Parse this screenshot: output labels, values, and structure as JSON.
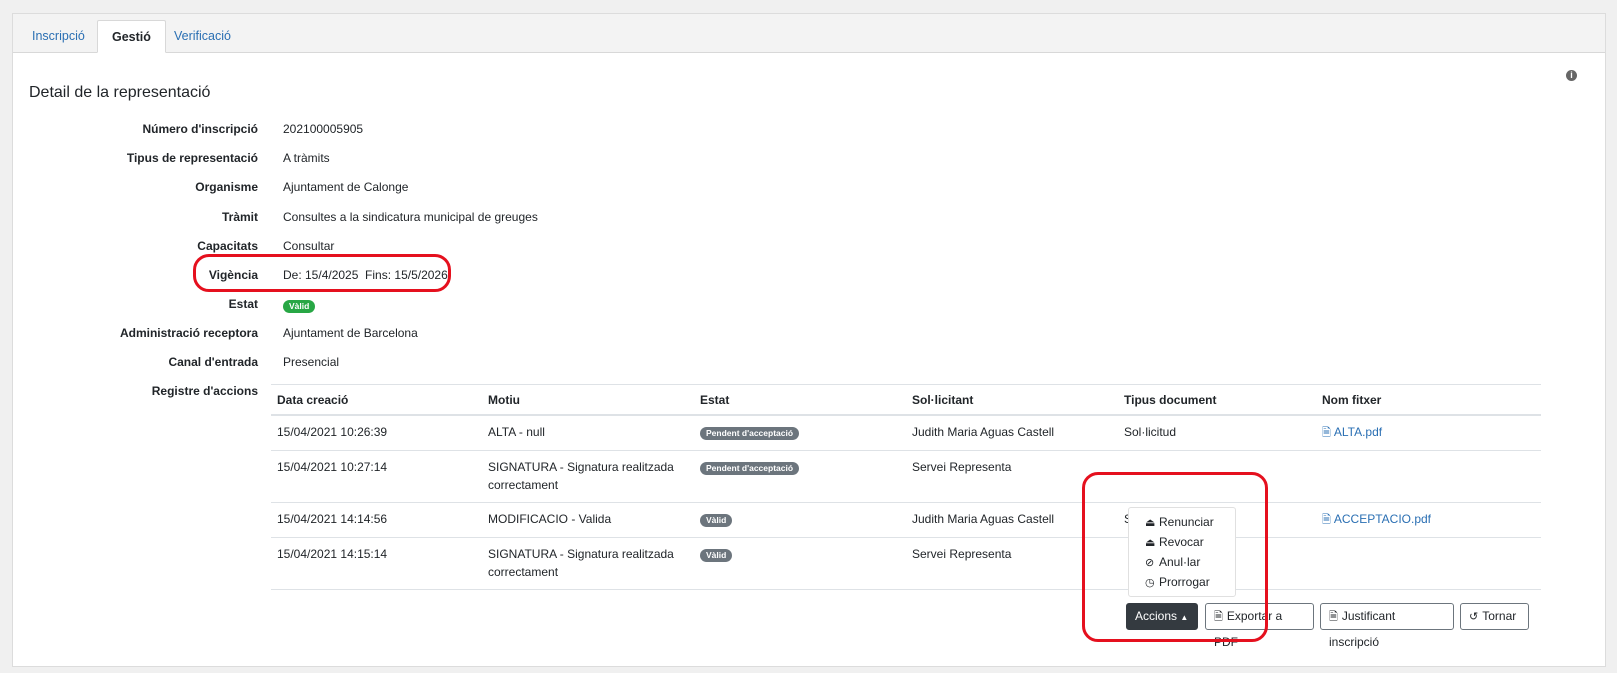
{
  "tabs": [
    {
      "label": "Inscripció"
    },
    {
      "label": "Gestió"
    },
    {
      "label": "Verificació"
    }
  ],
  "page_title": "Detail de la representació",
  "fields": {
    "numero_label": "Número d'inscripció",
    "numero_value": "202100005905",
    "tipus_label": "Tipus de representació",
    "tipus_value": "A tràmits",
    "organisme_label": "Organisme",
    "organisme_value": "Ajuntament de Calonge",
    "tramit_label": "Tràmit",
    "tramit_value": "Consultes a la sindicatura municipal de greuges",
    "capacitats_label": "Capacitats",
    "capacitats_value": "Consultar",
    "vigencia_label": "Vigència",
    "vigencia_value": "De: 15/4/2025  Fins: 15/5/2026",
    "estat_label": "Estat",
    "estat_value": "Vàlid",
    "admin_label": "Administració receptora",
    "admin_value": "Ajuntament de Barcelona",
    "canal_label": "Canal d'entrada",
    "canal_value": "Presencial",
    "registre_label": "Registre d'accions"
  },
  "table": {
    "headers": [
      "Data creació",
      "Motiu",
      "Estat",
      "Sol·licitant",
      "Tipus document",
      "Nom fitxer"
    ],
    "rows": [
      {
        "data": "15/04/2021 10:26:39",
        "motiu": "ALTA - null",
        "estat": "Pendent d'acceptació",
        "sollicitant": "Judith Maria Aguas Castell",
        "tipus": "Sol·licitud",
        "fitxer": "ALTA.pdf"
      },
      {
        "data": "15/04/2021 10:27:14",
        "motiu": "SIGNATURA - Signatura realitzada correctament",
        "estat": "Pendent d'acceptació",
        "sollicitant": "Servei Representa",
        "tipus": "",
        "fitxer": ""
      },
      {
        "data": "15/04/2021 14:14:56",
        "motiu": "MODIFICACIO - Valida",
        "estat": "Vàlid",
        "sollicitant": "Judith Maria Aguas Castell",
        "tipus": "Sol·licitud",
        "fitxer": "ACCEPTACIO.pdf"
      },
      {
        "data": "15/04/2021 14:15:14",
        "motiu": "SIGNATURA - Signatura realitzada correctament",
        "estat": "Vàlid",
        "sollicitant": "Servei Representa",
        "tipus": "",
        "fitxer": ""
      }
    ]
  },
  "dropdown": {
    "items": [
      {
        "label": "Renunciar",
        "icon": "eject-icon"
      },
      {
        "label": "Revocar",
        "icon": "eject-icon"
      },
      {
        "label": "Anul·lar",
        "icon": "ban-icon"
      },
      {
        "label": "Prorrogar",
        "icon": "clock-icon"
      }
    ]
  },
  "buttons": {
    "accions": "Accions",
    "exportar": "Exportar a PDF",
    "justificant": "Justificant inscripció",
    "tornar": "Tornar"
  },
  "colors": {
    "highlight": "#e5101e",
    "link": "#2a6fb3",
    "badge_valid": "#28a745",
    "badge_grey": "#6c757d"
  }
}
